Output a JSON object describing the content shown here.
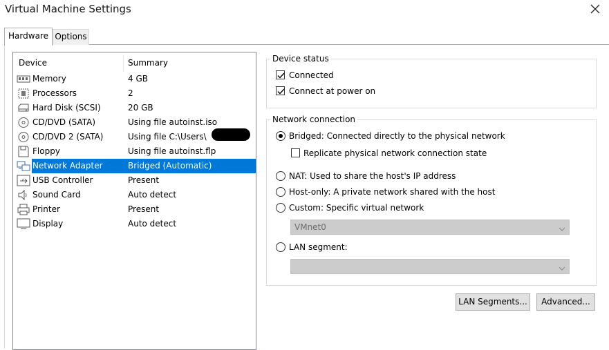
{
  "window": {
    "title": "Virtual Machine Settings"
  },
  "tabs": [
    {
      "label": "Hardware"
    },
    {
      "label": "Options"
    }
  ],
  "device_list": {
    "columns": {
      "device": "Device",
      "summary": "Summary"
    },
    "rows": [
      {
        "device": "Memory",
        "summary": "4 GB",
        "icon": "memory-icon"
      },
      {
        "device": "Processors",
        "summary": "2",
        "icon": "processor-icon"
      },
      {
        "device": "Hard Disk (SCSI)",
        "summary": "20 GB",
        "icon": "hard-disk-icon"
      },
      {
        "device": "CD/DVD (SATA)",
        "summary": "Using file autoinst.iso",
        "icon": "cd-dvd-icon"
      },
      {
        "device": "CD/DVD 2 (SATA)",
        "summary": "Using file C:\\Users\\",
        "icon": "cd-dvd-icon"
      },
      {
        "device": "Floppy",
        "summary": "Using file autoinst.flp",
        "icon": "floppy-icon"
      },
      {
        "device": "Network Adapter",
        "summary": "Bridged (Automatic)",
        "icon": "network-adapter-icon",
        "selected": true
      },
      {
        "device": "USB Controller",
        "summary": "Present",
        "icon": "usb-icon"
      },
      {
        "device": "Sound Card",
        "summary": "Auto detect",
        "icon": "speaker-icon"
      },
      {
        "device": "Printer",
        "summary": "Present",
        "icon": "printer-icon"
      },
      {
        "device": "Display",
        "summary": "Auto detect",
        "icon": "monitor-icon"
      }
    ]
  },
  "device_status": {
    "label": "Device status",
    "connected": {
      "label": "Connected",
      "checked": true
    },
    "connect_at_power_on": {
      "label": "Connect at power on",
      "checked": true
    }
  },
  "network_connection": {
    "label": "Network connection",
    "bridged": {
      "label": "Bridged: Connected directly to the physical network",
      "selected": true
    },
    "replicate": {
      "label": "Replicate physical network connection state",
      "checked": false
    },
    "nat": {
      "label": "NAT: Used to share the host's IP address"
    },
    "host_only": {
      "label": "Host-only: A private network shared with the host"
    },
    "custom": {
      "label": "Custom: Specific virtual network"
    },
    "custom_select": {
      "value": "VMnet0"
    },
    "lan_segment": {
      "label": "LAN segment:"
    },
    "lan_select": {
      "value": ""
    }
  },
  "buttons": {
    "lan_segments": "LAN Segments...",
    "advanced": "Advanced..."
  },
  "colors": {
    "selection": "#0078d7",
    "disabled_combo": "#cccccc"
  }
}
